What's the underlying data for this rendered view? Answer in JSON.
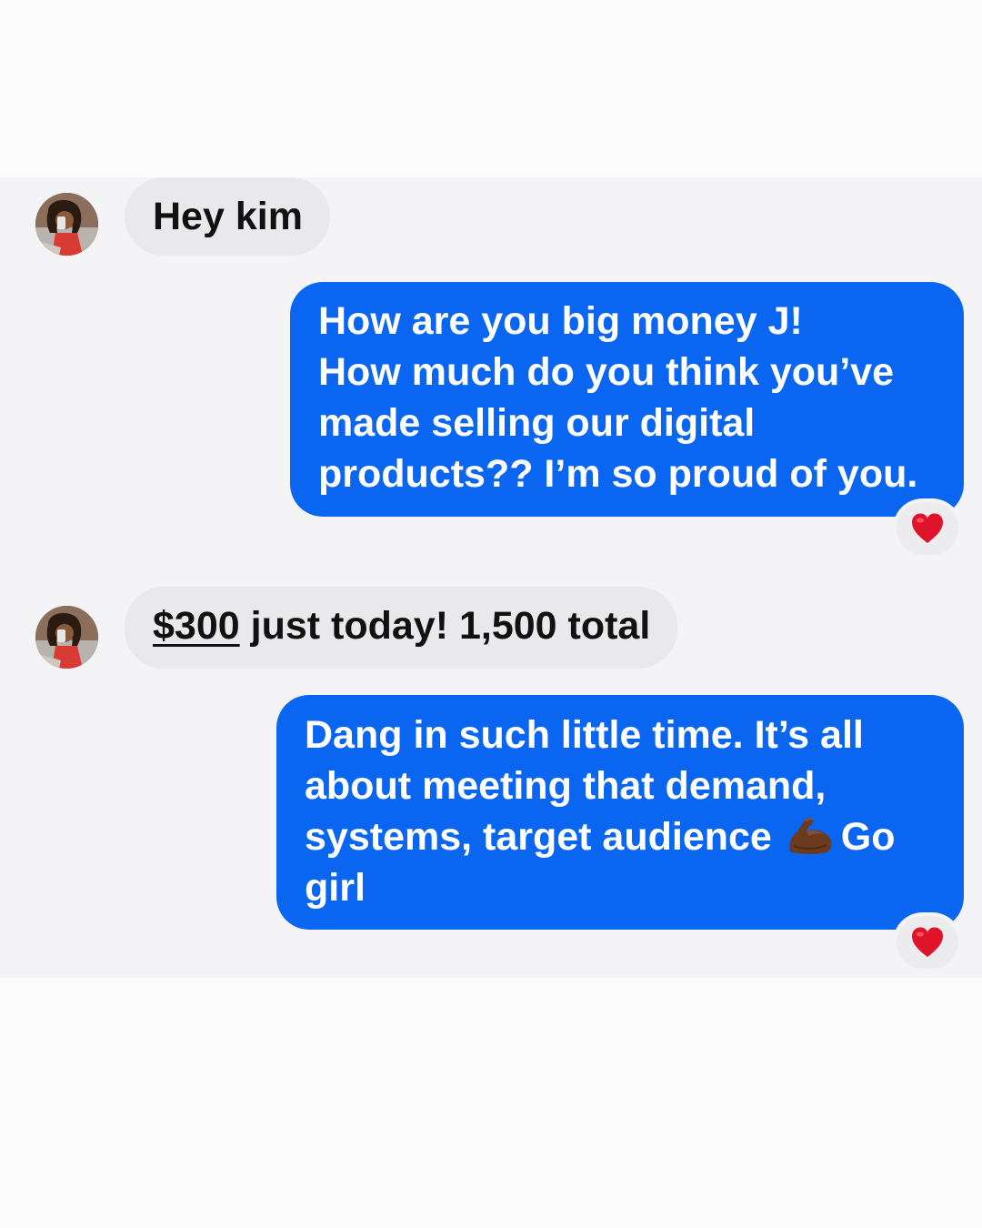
{
  "messages": [
    {
      "sender": "them",
      "text": "Hey kim"
    },
    {
      "sender": "me",
      "lines": [
        "How are you big money J!",
        "How much do you think you’ve",
        "made selling our digital",
        "products?? I’m so proud of you."
      ],
      "reaction": "heart-icon"
    },
    {
      "sender": "them",
      "amount": "$300",
      "text": " just today! 1,500 total"
    },
    {
      "sender": "me",
      "lines": [
        "Dang in such little time. It’s all",
        "about meeting that demand,",
        "systems, target audience",
        "Go",
        "girl"
      ],
      "emoji": "flexed-biceps-icon",
      "reaction": "heart-icon"
    }
  ],
  "colors": {
    "outgoing_bubble": "#0a66f0",
    "incoming_bubble": "#e9e9eb",
    "chat_background": "#f4f4f6",
    "heart": "#e0132b"
  }
}
